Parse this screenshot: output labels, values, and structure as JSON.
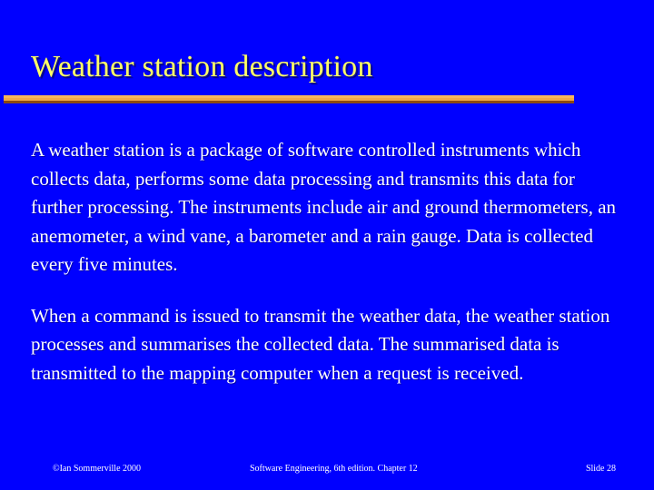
{
  "slide": {
    "title": "Weather station description",
    "background_color": "#0000FF",
    "title_color": "#FFFF66",
    "rule_color": "#F0A848",
    "body_color": "#FFFFFF",
    "paragraphs": [
      "A weather station is a package of software controlled instruments which collects data, performs some data processing and transmits this data for further processing. The instruments include air and ground thermometers, an anemometer, a wind vane, a barometer and a rain gauge. Data is collected every five minutes.",
      "When a command is issued to transmit the weather data, the weather station processes and summarises the collected data. The summarised data is transmitted to the mapping computer when a request is received."
    ],
    "footer": {
      "left": "©Ian Sommerville 2000",
      "center": "Software Engineering, 6th edition. Chapter 12",
      "right": "Slide 28"
    }
  }
}
